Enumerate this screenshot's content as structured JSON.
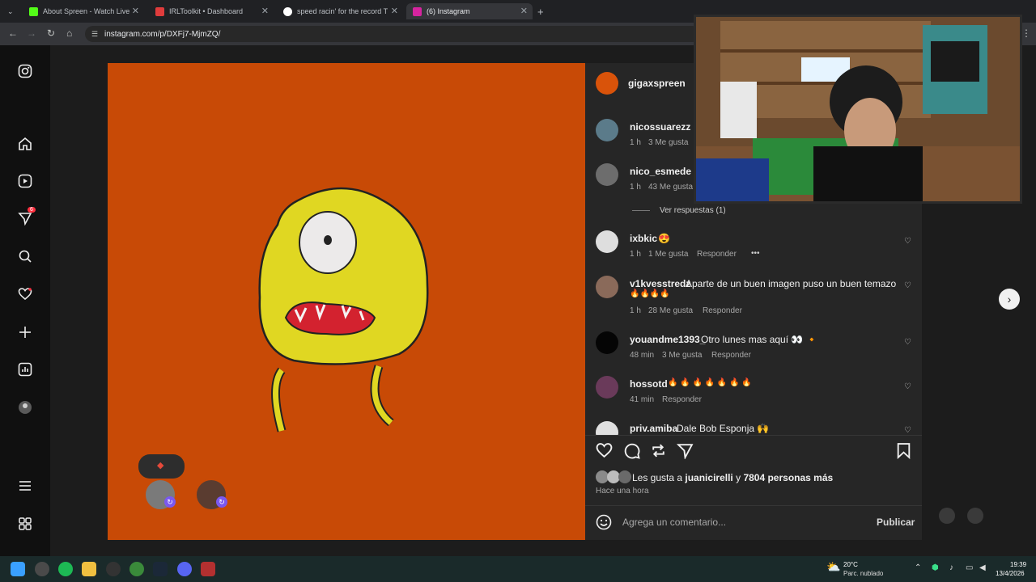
{
  "browser": {
    "tabs": [
      {
        "title": "About Spreen - Watch Live on K",
        "color": "#53fc18"
      },
      {
        "title": "IRLToolkit • Dashboard",
        "color": "#e03c3c"
      },
      {
        "title": "speed racin' for the record TRA",
        "color": "#ffffff"
      },
      {
        "title": "(6) Instagram",
        "color": "#d6249f"
      }
    ],
    "new_tab": "+",
    "url": "instagram.com/p/DXFj7-MjmZQ/"
  },
  "sidebar": {
    "badge_count": "6"
  },
  "post": {
    "author": "gigaxspreen",
    "comments": [
      {
        "user": "nicossuarezz",
        "text": "",
        "time": "1 h",
        "likes": "3 Me gusta",
        "reply": ""
      },
      {
        "user": "nico_esmede",
        "text": "",
        "time": "1 h",
        "likes": "43 Me gusta",
        "reply": ""
      },
      {
        "user": "ixbkic",
        "text": "😍",
        "time": "1 h",
        "likes": "1 Me gusta",
        "reply": "Responder",
        "more": "•••"
      },
      {
        "user": "v1kvesstredz",
        "text": "Aparte de un buen imagen puso un buen temazo",
        "text2": "🔥🔥🔥🔥",
        "time": "1 h",
        "likes": "28 Me gusta",
        "reply": "Responder"
      },
      {
        "user": "youandme1393_",
        "text": "Otro lunes mas aquí 👀 🔸",
        "time": "48 min",
        "likes": "3 Me gusta",
        "reply": "Responder"
      },
      {
        "user": "hossotd",
        "text": "🔥 🔥 🔥 🔥 🔥 🔥 🔥",
        "time": "41 min",
        "likes": "",
        "reply": "Responder"
      },
      {
        "user": "priv.amiba",
        "text": "Dale Bob Esponja 🙌",
        "time": "",
        "likes": "",
        "reply": ""
      }
    ],
    "view_replies": "Ver respuestas (1)",
    "likes_prefix": "Les gusta a",
    "likes_user": "juanicirelli",
    "likes_mid": "y",
    "likes_rest": "7804 personas más",
    "timestamp": "Hace una hora",
    "comment_placeholder": "Agrega un comentario...",
    "publish_label": "Publicar"
  },
  "taskbar": {
    "weather_temp": "20°C",
    "weather_desc": "Parc. nublado",
    "time": "19:39",
    "date": "13/4/2026"
  }
}
